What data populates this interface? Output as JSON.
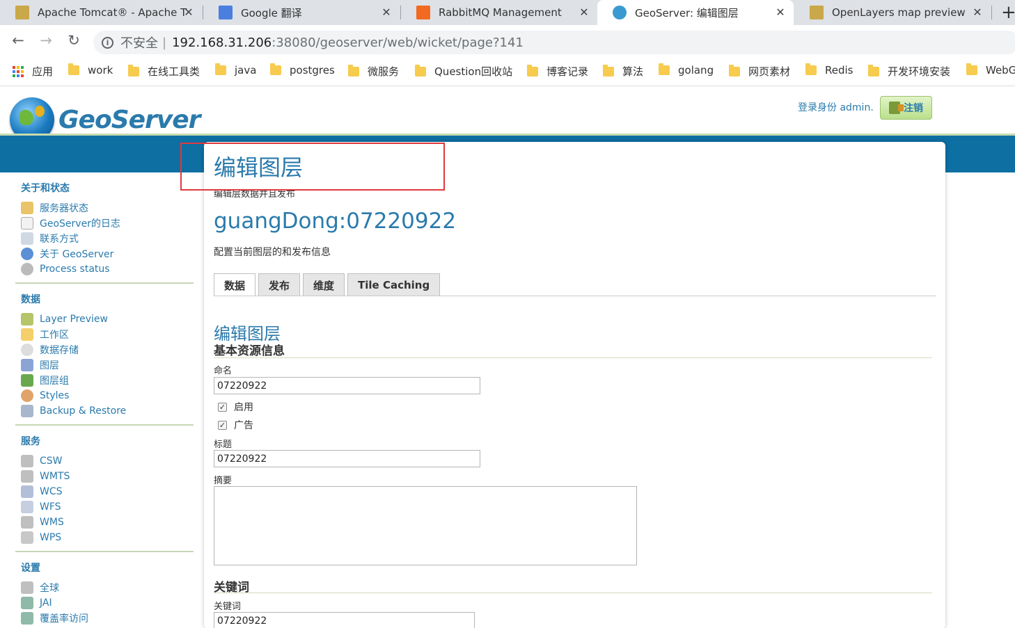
{
  "browser": {
    "tabs": [
      {
        "title": "Apache Tomcat® - Apache T",
        "active": false
      },
      {
        "title": "Google 翻译",
        "active": false
      },
      {
        "title": "RabbitMQ Management",
        "active": false
      },
      {
        "title": "GeoServer: 编辑图层",
        "active": true
      },
      {
        "title": "OpenLayers map preview",
        "active": false
      }
    ],
    "close_glyph": "✕",
    "new_tab_glyph": "+",
    "address": {
      "insecure_label": "不安全",
      "separator": "|",
      "host": "192.168.31.206",
      "path": ":38080/geoserver/web/wicket/page?141"
    },
    "bookmarks": [
      "应用",
      "work",
      "在线工具类",
      "java",
      "postgres",
      "微服务",
      "Question回收站",
      "博客记录",
      "算法",
      "golang",
      "网页素材",
      "Redis",
      "开发环境安装",
      "WebG"
    ]
  },
  "header": {
    "logo_text": "GeoServer",
    "login_text": "登录身份 admin.",
    "logout_label": "注销"
  },
  "sidebar": {
    "groups": [
      {
        "title": "关于和状态",
        "items": [
          "服务器状态",
          "GeoServer的日志",
          "联系方式",
          "关于 GeoServer",
          "Process status"
        ]
      },
      {
        "title": "数据",
        "items": [
          "Layer Preview",
          "工作区",
          "数据存储",
          "图层",
          "图层组",
          "Styles",
          "Backup & Restore"
        ]
      },
      {
        "title": "服务",
        "items": [
          "CSW",
          "WMTS",
          "WCS",
          "WFS",
          "WMS",
          "WPS"
        ]
      },
      {
        "title": "设置",
        "items": [
          "全球",
          "JAI",
          "覆盖率访问"
        ]
      }
    ]
  },
  "content": {
    "page_title": "编辑图层",
    "page_desc": "编辑层数据并且发布",
    "layer_name": "guangDong:07220922",
    "layer_desc": "配置当前图层的和发布信息",
    "tabs": [
      "数据",
      "发布",
      "维度",
      "Tile Caching"
    ],
    "section_title": "编辑图层",
    "basic_info": "基本资源信息",
    "name_label": "命名",
    "name_value": "07220922",
    "enabled_label": "启用",
    "advertised_label": "广告",
    "title_label": "标题",
    "title_value": "07220922",
    "abstract_label": "摘要",
    "keywords_heading": "关键词",
    "keywords_label": "关键词",
    "keywords_value": "07220922"
  },
  "colors": {
    "accent": "#2a7aac",
    "banner": "#0e6fa2",
    "highlight": "#e0383e"
  }
}
